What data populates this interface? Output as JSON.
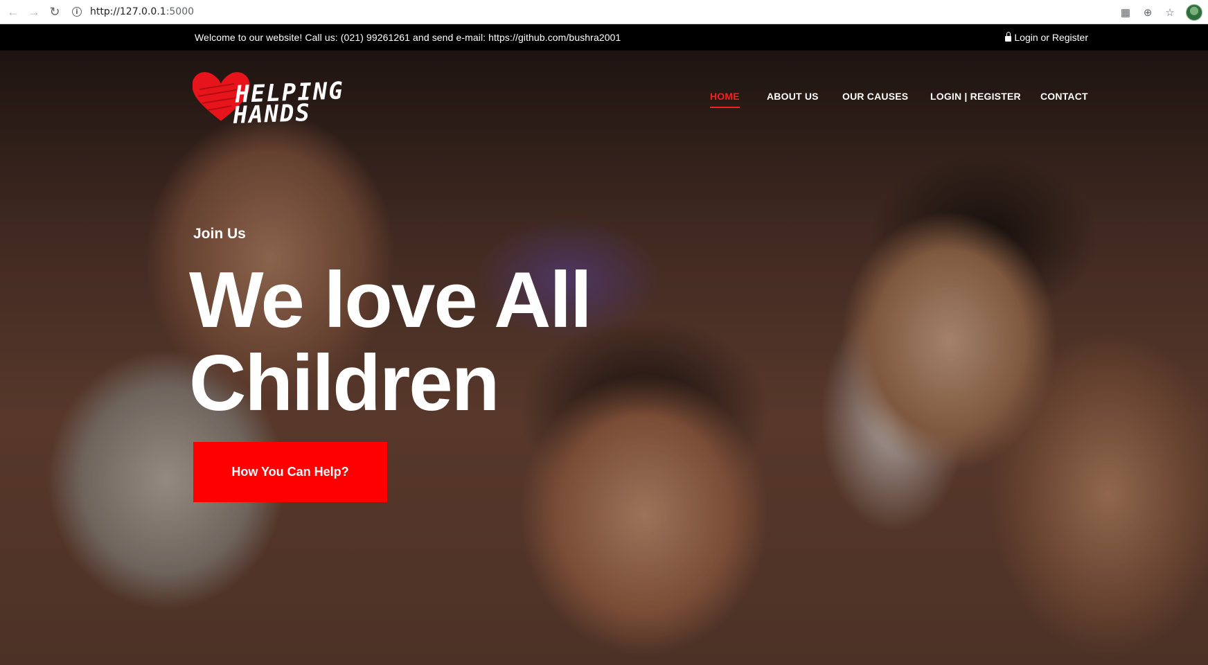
{
  "browser": {
    "url_host": "http://127.0.0.1",
    "url_port": ":5000",
    "back_icon": "←",
    "forward_icon": "→",
    "reload_icon": "↻",
    "info_icon": "i",
    "qr_icon": "▦",
    "zoom_icon": "⊕",
    "star_icon": "☆"
  },
  "topbar": {
    "contact_text": "Welcome to our website! Call us: (021) 99261261 and send e-mail: https://github.com/bushra2001",
    "login_text": "Login or Register"
  },
  "logo": {
    "line1": "HELPING",
    "line2": "HANDS",
    "heart_color": "#e8141b"
  },
  "nav": {
    "items": [
      {
        "label": "HOME",
        "active": true
      },
      {
        "label": "ABOUT US",
        "active": false
      },
      {
        "label": "OUR CAUSES",
        "active": false
      },
      {
        "label": "LOGIN | REGISTER",
        "active": false
      },
      {
        "label": "CONTACT",
        "active": false
      }
    ]
  },
  "hero": {
    "eyebrow": "Join Us",
    "title_line1": "We love All",
    "title_line2": "Children",
    "cta_label": "How You Can Help?"
  },
  "colors": {
    "accent": "#ff0000",
    "topbar_bg": "#000000",
    "nav_active": "#ff1e1e"
  }
}
